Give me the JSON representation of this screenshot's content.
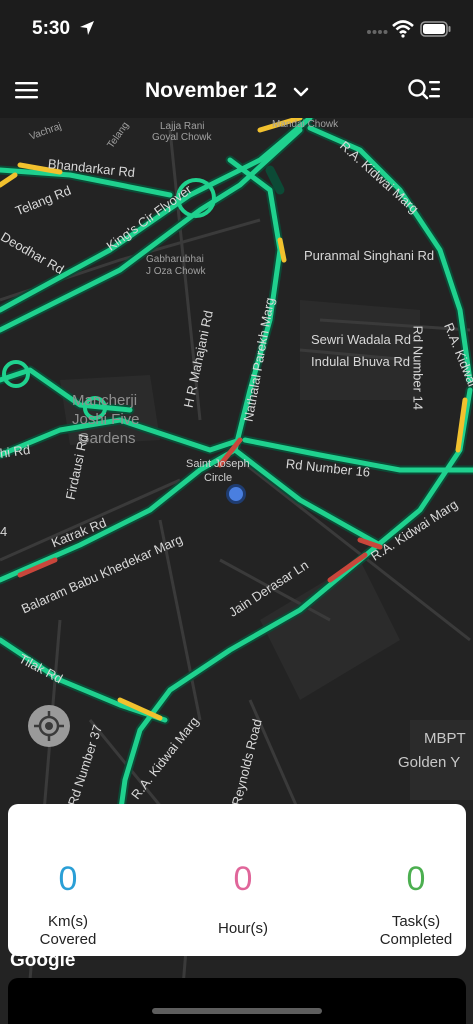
{
  "status_bar": {
    "time": "5:30"
  },
  "header": {
    "date_title": "November 12"
  },
  "map": {
    "labels": {
      "vachraj": "Vachraj",
      "telang_top": "Telang",
      "lajja": "Lajja Rani",
      "goyal": "Goyal Chowk",
      "mandai": "Mandai Chowk",
      "bhandarkar": "Bhandarkar Rd",
      "ra_kidwai_top": "R.A. Kidwai Marg",
      "telang_rd": "Telang Rd",
      "kings_circle": "King's Cir Flyover",
      "deodhar": "Deodhar Rd",
      "gabharubhai": "Gabharubhai",
      "joza": "J Oza Chowk",
      "puranmal": "Puranmal Singhani Rd",
      "ra_kidwai_right": "R.A. Kidwai",
      "hr_mahajani": "H R Mahajani Rd",
      "nathalal": "Nathalal Parekh Marg",
      "sewri": "Sewri Wadala Rd",
      "indulal": "Indulal Bhuva Rd",
      "rd_14": "Rd Number 14",
      "mancherji_1": "Mancherji",
      "mancherji_2": "Joshi Five",
      "mancherji_3": "Gardens",
      "hi_rd": "hi Rd",
      "firdausi": "Firdausi Rd",
      "st_joseph_1": "Saint Joseph",
      "st_joseph_2": "Circle",
      "rd_16": "Rd Number 16",
      "ra_kidwai_mid": "R.A. Kidwai Marg",
      "num_4": "4",
      "katrak": "Katrak Rd",
      "balaram": "Balaram Babu Khedekar Marg",
      "jain_derasar": "Jain Derasar Ln",
      "tilak": "Tilak Rd",
      "rd_37": "Rd Number 37",
      "ra_kidwai_bottom": "R.A. Kidwai Marg",
      "reynolds": "Reynolds Road",
      "mbpt": "MBPT",
      "golden": "Golden Y",
      "google": "Google"
    }
  },
  "stats": {
    "km_value": "0",
    "km_label_1": "Km(s)",
    "km_label_2": "Covered",
    "hours_value": "0",
    "hours_label": "Hour(s)",
    "tasks_value": "0",
    "tasks_label_1": "Task(s)",
    "tasks_label_2": "Completed"
  },
  "colors": {
    "km": "#2a9fd6",
    "hours": "#e0669a",
    "tasks": "#4caf50",
    "traffic_green": "#1fd18e",
    "traffic_yellow": "#f2c12e",
    "traffic_red": "#c9463b"
  },
  "icons": {
    "location_arrow": "location-arrow-icon",
    "wifi": "wifi-icon",
    "battery": "battery-icon",
    "menu": "hamburger-menu-icon",
    "chevron": "chevron-down-icon",
    "task_list": "search-list-icon",
    "locate": "crosshair-icon"
  }
}
